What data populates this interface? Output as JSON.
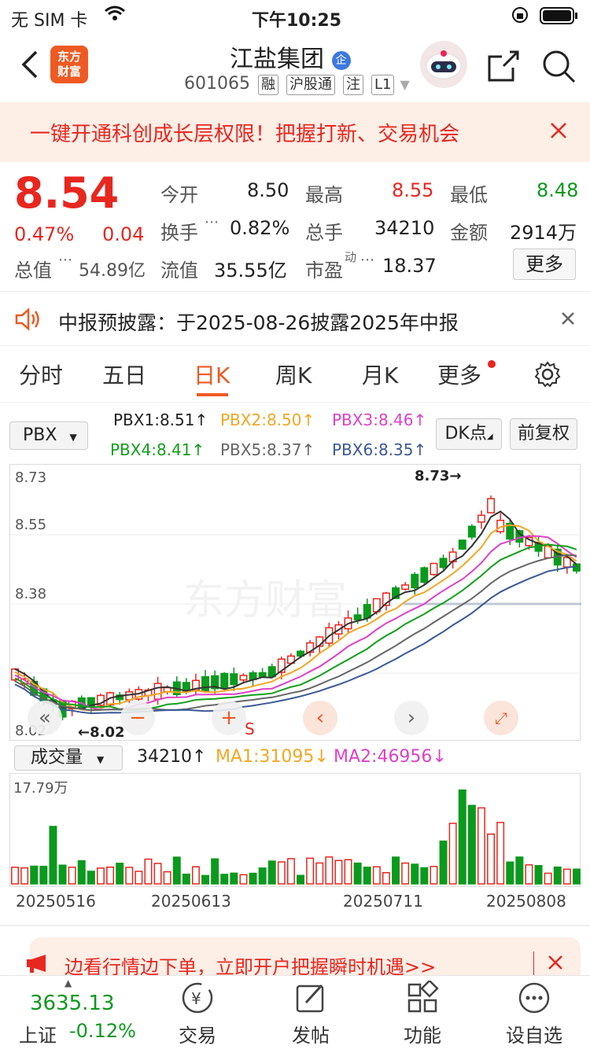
{
  "status_bar": {
    "carrier": "无 SIM 卡",
    "time": "下午10:25"
  },
  "header": {
    "logo_text": "东方财富",
    "stock_name": "江盐集团",
    "name_badge": "企",
    "code": "601065",
    "tags": [
      "融",
      "沪股通",
      "注",
      "L1"
    ]
  },
  "banner": {
    "text": "一键开通科创成长层权限！把握打新、交易机会"
  },
  "quote": {
    "price": "8.54",
    "change_pct": "0.47%",
    "change": "0.04",
    "open_label": "今开",
    "open": "8.50",
    "high_label": "最高",
    "high": "8.55",
    "low_label": "最低",
    "low": "8.48",
    "turnover_label": "换手",
    "turnover": "0.82%",
    "volume_label": "总手",
    "volume": "34210",
    "amount_label": "金额",
    "amount": "2914万",
    "mktcap_label": "总值",
    "mktcap": "54.89亿",
    "float_label": "流值",
    "float": "35.55亿",
    "pe_label": "市盈",
    "pe_sup": "动",
    "pe": "18.37",
    "more_label": "更多"
  },
  "notice": {
    "text": "中报预披露：于2025-08-26披露2025年中报"
  },
  "tabs": [
    "分时",
    "五日",
    "日K",
    "周K",
    "月K",
    "更多"
  ],
  "active_tab": "日K",
  "indicator": {
    "selector": "PBX",
    "items": [
      {
        "label": "PBX1:8.51",
        "arrow": "↑",
        "color": "#333333"
      },
      {
        "label": "PBX2:8.50",
        "arrow": "↑",
        "color": "#f5a623"
      },
      {
        "label": "PBX3:8.46",
        "arrow": "↑",
        "color": "#e040c8"
      },
      {
        "label": "PBX4:8.41",
        "arrow": "↑",
        "color": "#11a01a"
      },
      {
        "label": "PBX5:8.37",
        "arrow": "↑",
        "color": "#666666"
      },
      {
        "label": "PBX6:8.35",
        "arrow": "↑",
        "color": "#3b5998"
      }
    ],
    "dk_label": "DK点",
    "fq_label": "前复权"
  },
  "kline": {
    "y_labels": [
      "8.73",
      "8.55",
      "8.38",
      "8.02"
    ],
    "max_mark": "8.73→",
    "min_mark": "←8.02",
    "watermark": "东方财富",
    "s_mark": "S"
  },
  "volume": {
    "selector": "成交量",
    "vol_label": "34210",
    "vol_arrow": "↑",
    "ma1_label": "MA1:31095",
    "ma1_arrow": "↓",
    "ma2_label": "MA2:46956",
    "ma2_arrow": "↓",
    "max_label": "17.79万",
    "dates": [
      "20250516",
      "20250613",
      "20250711",
      "20250808"
    ]
  },
  "promo": {
    "text": "边看行情边下单，立即开户把握瞬时机遇>>"
  },
  "bottom_nav": {
    "index_value": "3635.13",
    "index_name": "上证",
    "index_change": "-0.12%",
    "items": [
      "交易",
      "发帖",
      "功能",
      "设自选"
    ]
  }
}
